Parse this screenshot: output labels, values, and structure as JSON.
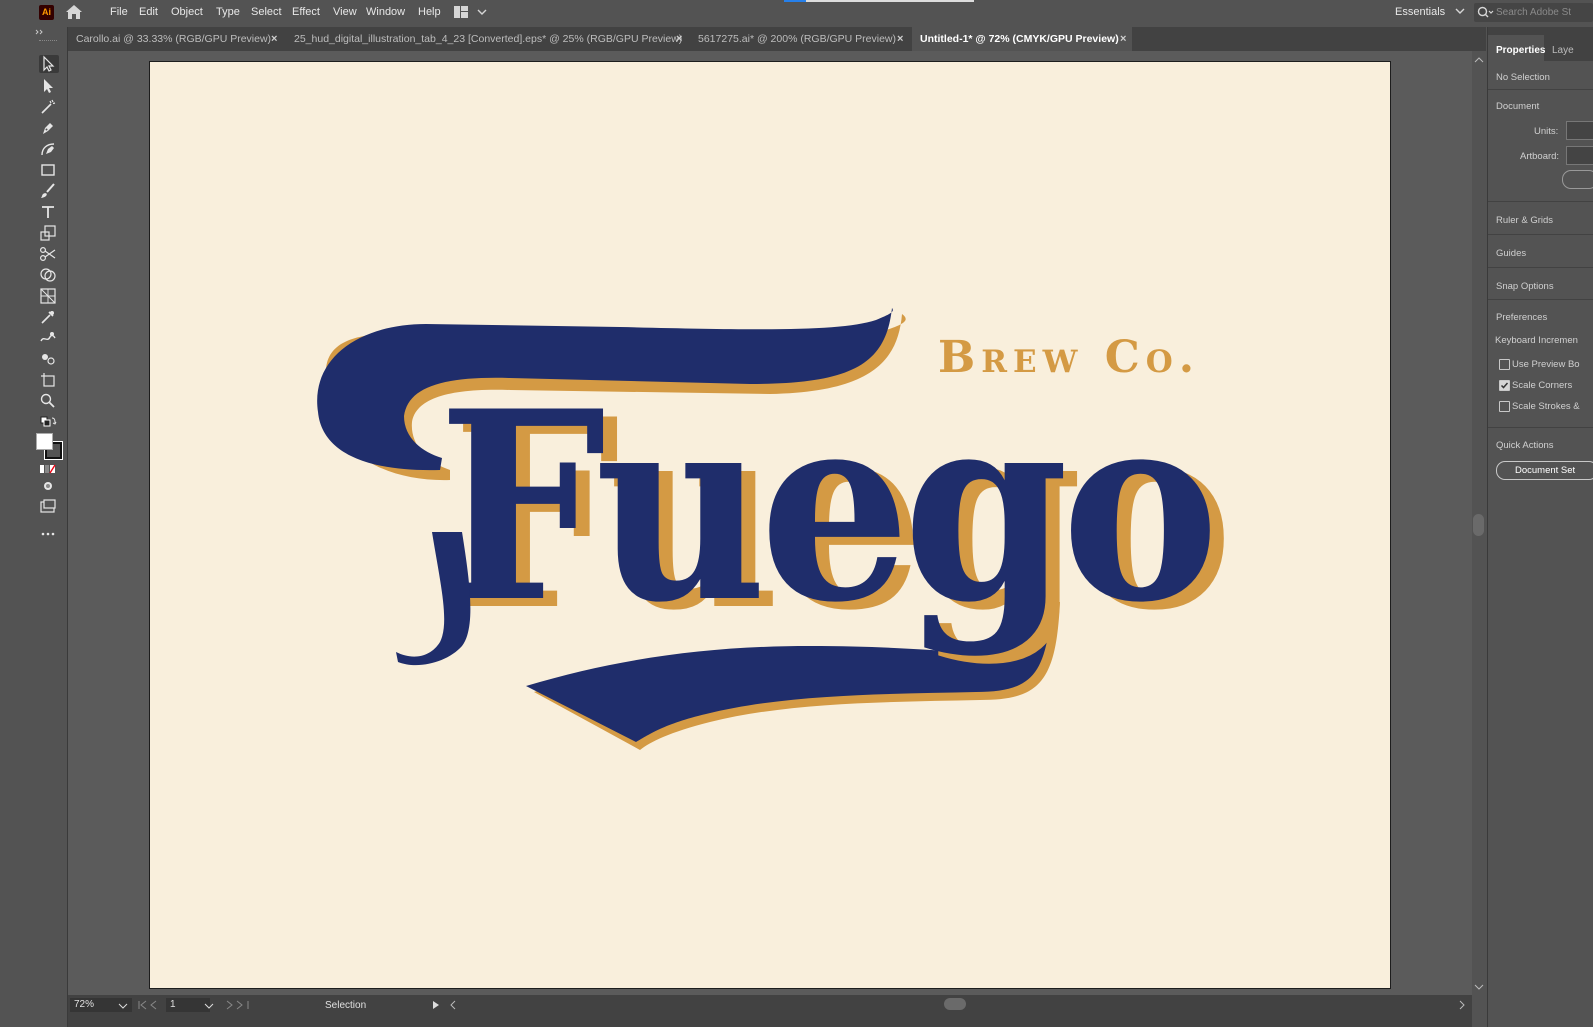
{
  "app": {
    "logo": "Ai"
  },
  "menubar": {
    "items": [
      "File",
      "Edit",
      "Object",
      "Type",
      "Select",
      "Effect",
      "View",
      "Window",
      "Help"
    ],
    "workspace": "Essentials",
    "search_placeholder": "Search Adobe St"
  },
  "tabs": [
    {
      "label": "Carollo.ai @ 33.33% (RGB/GPU Preview)",
      "active": false
    },
    {
      "label": "25_hud_digital_illustration_tab_4_23 [Converted].eps* @ 25% (RGB/GPU Preview)",
      "active": false
    },
    {
      "label": "5617275.ai* @ 200% (RGB/GPU Preview)",
      "active": false
    },
    {
      "label": "Untitled-1* @ 72% (CMYK/GPU Preview)",
      "active": true
    }
  ],
  "tab_close_glyph": "×",
  "artwork": {
    "wordmark": "Fuego",
    "tagline": "Brew Co.",
    "colors": {
      "navy": "#1f2d6b",
      "gold": "#d49a44",
      "paper": "#f9efdc"
    }
  },
  "statusbar": {
    "zoom": "72%",
    "page": "1",
    "tool": "Selection"
  },
  "panel": {
    "tabs": [
      "Properties",
      "Laye"
    ],
    "selection": "No Selection",
    "document_section": "Document",
    "units_label": "Units:",
    "artboard_label": "Artboard:",
    "ruler_grids": "Ruler & Grids",
    "guides": "Guides",
    "snap_options": "Snap Options",
    "preferences": "Preferences",
    "keyboard_increment": "Keyboard Incremen",
    "checkboxes": [
      {
        "label": "Use Preview Bo",
        "checked": false
      },
      {
        "label": "Scale Corners",
        "checked": true
      },
      {
        "label": "Scale Strokes &",
        "checked": false
      }
    ],
    "quick_actions": "Quick Actions",
    "document_setup_button": "Document Set"
  }
}
